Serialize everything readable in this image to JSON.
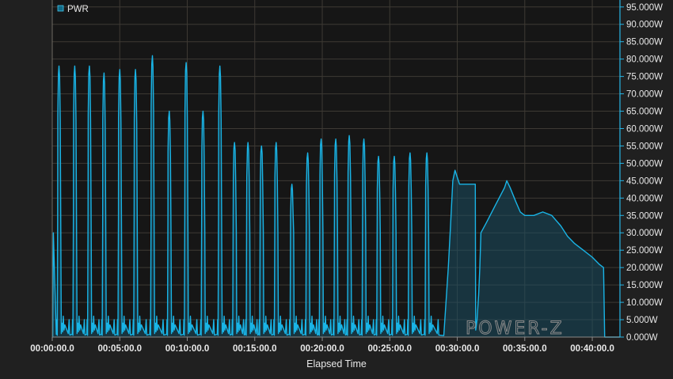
{
  "chart_data": {
    "type": "area",
    "xlabel": "Elapsed Time",
    "x_unit": "seconds",
    "xlim": [
      0,
      2523
    ],
    "ylim": [
      0,
      97
    ],
    "x_ticks": [
      {
        "value": 0,
        "label": "00:00:00.0"
      },
      {
        "value": 300,
        "label": "00:05:00.0"
      },
      {
        "value": 600,
        "label": "00:10:00.0"
      },
      {
        "value": 900,
        "label": "00:15:00.0"
      },
      {
        "value": 1200,
        "label": "00:20:00.0"
      },
      {
        "value": 1500,
        "label": "00:25:00.0"
      },
      {
        "value": 1800,
        "label": "00:30:00.0"
      },
      {
        "value": 2100,
        "label": "00:35:00.0"
      },
      {
        "value": 2400,
        "label": "00:40:00.0"
      }
    ],
    "y_ticks": [
      {
        "value": 0,
        "label": "0.000W"
      },
      {
        "value": 5,
        "label": "5.000W"
      },
      {
        "value": 10,
        "label": "10.000W"
      },
      {
        "value": 15,
        "label": "15.000W"
      },
      {
        "value": 20,
        "label": "20.000W"
      },
      {
        "value": 25,
        "label": "25.000W"
      },
      {
        "value": 30,
        "label": "30.000W"
      },
      {
        "value": 35,
        "label": "35.000W"
      },
      {
        "value": 40,
        "label": "40.000W"
      },
      {
        "value": 45,
        "label": "45.000W"
      },
      {
        "value": 50,
        "label": "50.000W"
      },
      {
        "value": 55,
        "label": "55.000W"
      },
      {
        "value": 60,
        "label": "60.000W"
      },
      {
        "value": 65,
        "label": "65.000W"
      },
      {
        "value": 70,
        "label": "70.000W"
      },
      {
        "value": 75,
        "label": "75.000W"
      },
      {
        "value": 80,
        "label": "80.000W"
      },
      {
        "value": 85,
        "label": "85.000W"
      },
      {
        "value": 90,
        "label": "90.000W"
      },
      {
        "value": 95,
        "label": "95.000W"
      }
    ],
    "grid": true,
    "y_axis_side": "right",
    "legend": {
      "position": "top-left",
      "entries": [
        "PWR"
      ]
    },
    "series": [
      {
        "name": "PWR",
        "color": "#19b4e6",
        "bursts": [
          {
            "t": 30,
            "peak": 78
          },
          {
            "t": 100,
            "peak": 78
          },
          {
            "t": 165,
            "peak": 78
          },
          {
            "t": 230,
            "peak": 76
          },
          {
            "t": 300,
            "peak": 77
          },
          {
            "t": 370,
            "peak": 77
          },
          {
            "t": 445,
            "peak": 81
          },
          {
            "t": 520,
            "peak": 65
          },
          {
            "t": 595,
            "peak": 79
          },
          {
            "t": 670,
            "peak": 65
          },
          {
            "t": 745,
            "peak": 78
          },
          {
            "t": 810,
            "peak": 56
          },
          {
            "t": 870,
            "peak": 56
          },
          {
            "t": 930,
            "peak": 55
          },
          {
            "t": 995,
            "peak": 56
          },
          {
            "t": 1065,
            "peak": 44
          },
          {
            "t": 1135,
            "peak": 53
          },
          {
            "t": 1195,
            "peak": 57
          },
          {
            "t": 1260,
            "peak": 57
          },
          {
            "t": 1320,
            "peak": 58
          },
          {
            "t": 1385,
            "peak": 57
          },
          {
            "t": 1450,
            "peak": 52
          },
          {
            "t": 1520,
            "peak": 52
          },
          {
            "t": 1590,
            "peak": 53
          },
          {
            "t": 1665,
            "peak": 53
          }
        ],
        "sustained": [
          [
            1760,
            20
          ],
          [
            1770,
            32
          ],
          [
            1780,
            45
          ],
          [
            1790,
            48
          ],
          [
            1800,
            46
          ],
          [
            1810,
            44
          ],
          [
            1830,
            44
          ],
          [
            1880,
            44
          ],
          [
            1882,
            2
          ],
          [
            1888,
            5
          ],
          [
            1895,
            12
          ],
          [
            1900,
            20
          ],
          [
            1905,
            30
          ],
          [
            1930,
            33
          ],
          [
            1970,
            38
          ],
          [
            2010,
            43
          ],
          [
            2020,
            45
          ],
          [
            2035,
            43
          ],
          [
            2060,
            39
          ],
          [
            2080,
            36
          ],
          [
            2100,
            35
          ],
          [
            2140,
            35
          ],
          [
            2180,
            36
          ],
          [
            2220,
            35
          ],
          [
            2260,
            32
          ],
          [
            2290,
            29
          ],
          [
            2320,
            27
          ],
          [
            2360,
            25
          ],
          [
            2400,
            23
          ],
          [
            2430,
            21
          ],
          [
            2450,
            20
          ],
          [
            2455,
            0
          ]
        ]
      }
    ]
  },
  "watermark": "POWER-Z"
}
